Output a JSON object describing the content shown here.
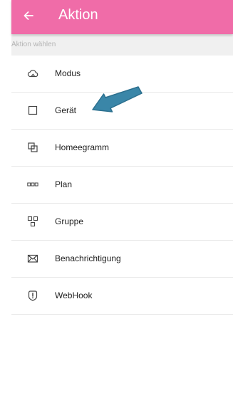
{
  "colors": {
    "primary": "#f06ca8",
    "icon": "#444444",
    "annotation_arrow": "#3a86a8"
  },
  "app_bar": {
    "back_icon": "arrow-left-icon",
    "title": "Aktion"
  },
  "section_header": {
    "label": "Aktion wählen"
  },
  "actions": [
    {
      "label": "Modus",
      "icon": "cloud-outline-icon"
    },
    {
      "label": "Gerät",
      "icon": "square-outline-icon"
    },
    {
      "label": "Homeegramm",
      "icon": "overlapping-squares-icon"
    },
    {
      "label": "Plan",
      "icon": "three-boxes-icon"
    },
    {
      "label": "Gruppe",
      "icon": "group-squares-icon"
    },
    {
      "label": "Benachrichtigung",
      "icon": "envelope-icon"
    },
    {
      "label": "WebHook",
      "icon": "exclamation-shield-icon"
    }
  ]
}
